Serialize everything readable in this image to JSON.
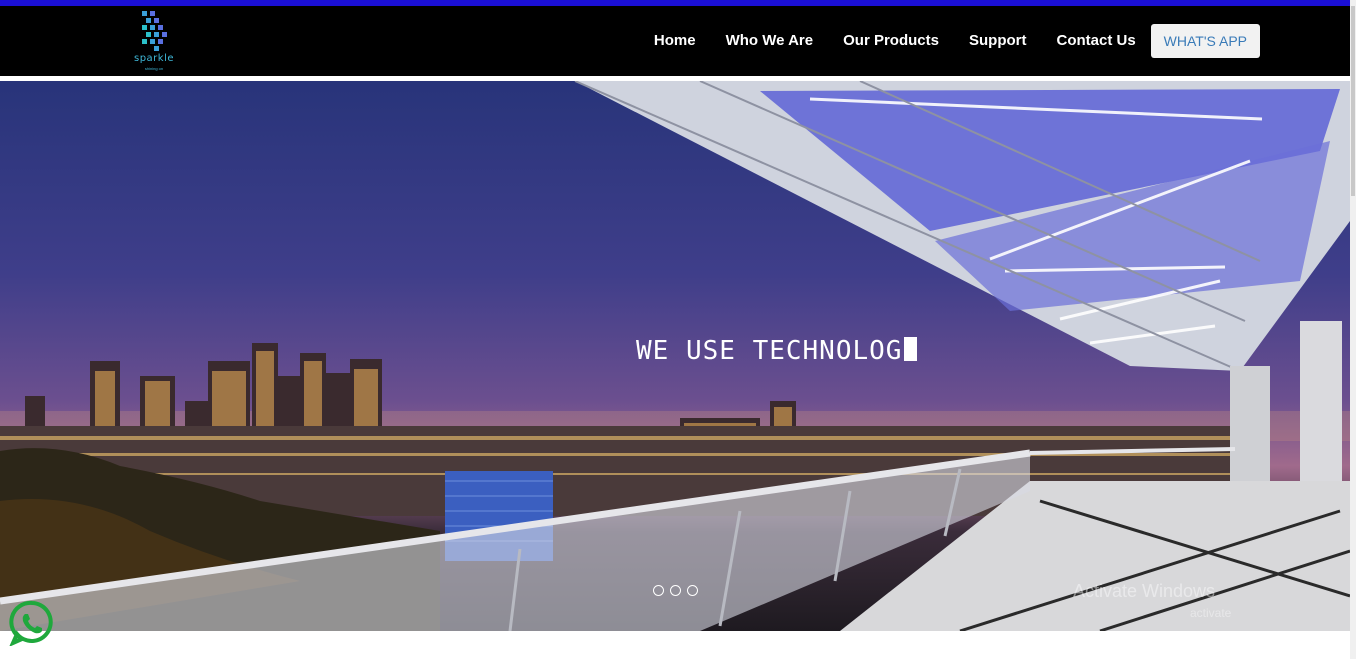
{
  "brand": {
    "logo_text": "sparkle",
    "logo_sub": "shining on"
  },
  "nav": {
    "items": [
      "Home",
      "Who We Are",
      "Our Products",
      "Support",
      "Contact Us"
    ],
    "whatsapp_label": "WHAT'S APP"
  },
  "hero": {
    "headline": "WE USE TECHNOLOG",
    "slide_count": 3,
    "watermark_title": "Activate Windows",
    "watermark_sub": "activate"
  },
  "colors": {
    "top_bar": "#1a0fd6",
    "nav_bg": "#000000",
    "whatsapp_green": "#25d366"
  },
  "icons": {
    "floating": "whatsapp-icon"
  }
}
